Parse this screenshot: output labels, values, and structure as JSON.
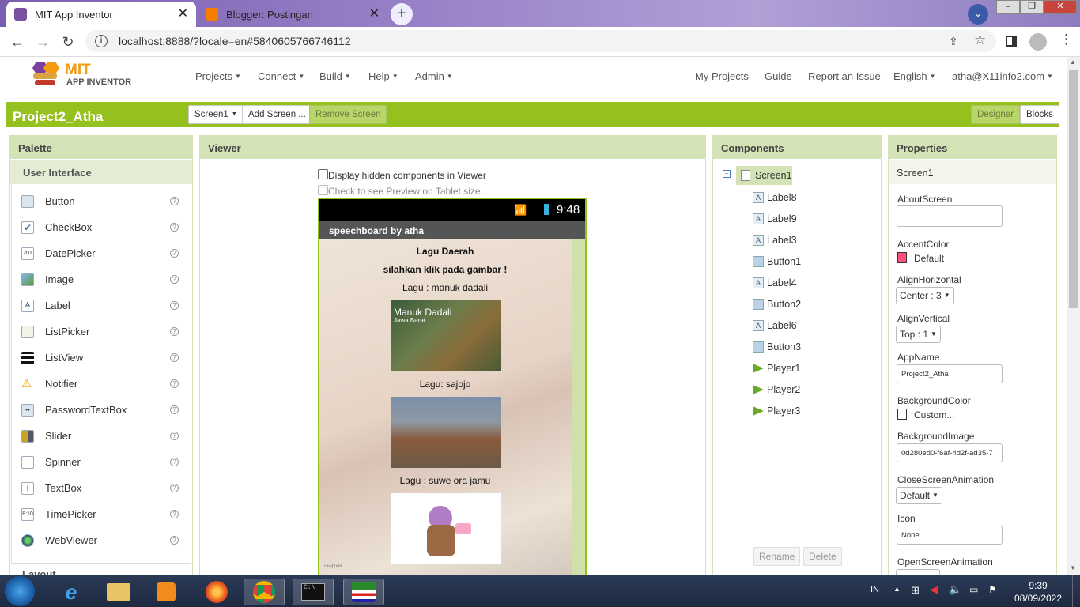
{
  "browser": {
    "tabs": [
      {
        "title": "MIT App Inventor",
        "active": true
      },
      {
        "title": "Blogger: Postingan",
        "active": false
      }
    ],
    "new_tab": "+",
    "url": "localhost:8888/?locale=en#5840605766746112",
    "window_controls": [
      "–",
      "❐",
      "✕"
    ]
  },
  "app": {
    "logo_top": "MIT",
    "logo_bottom": "APP INVENTOR",
    "menu": [
      "Projects",
      "Connect",
      "Build",
      "Help",
      "Admin"
    ],
    "right_menu": [
      "My Projects",
      "Guide",
      "Report an Issue",
      "English",
      "atha@X11info2.com"
    ]
  },
  "toolbar": {
    "project": "Project2_Atha",
    "screen_select": "Screen1",
    "add_screen": "Add Screen ...",
    "remove_screen": "Remove Screen",
    "designer": "Designer",
    "blocks": "Blocks"
  },
  "palette": {
    "title": "Palette",
    "section": "User Interface",
    "items": [
      "Button",
      "CheckBox",
      "DatePicker",
      "Image",
      "Label",
      "ListPicker",
      "ListView",
      "Notifier",
      "PasswordTextBox",
      "Slider",
      "Spinner",
      "TextBox",
      "TimePicker",
      "WebViewer"
    ],
    "next_section": "Layout"
  },
  "viewer": {
    "title": "Viewer",
    "hidden_cb": "Display hidden components in Viewer",
    "tablet_cb": "Check to see Preview on Tablet size.",
    "time": "9:48",
    "app_title": "speechboard by atha",
    "labels": [
      "Lagu Daerah",
      "silahkan klik pada gambar !",
      "Lagu : manuk dadali",
      "Lagu: sajojo",
      "Lagu : suwe ora jamu"
    ],
    "img1_title": "Manuk Dadali",
    "img1_sub": "Jawa Barat",
    "watermark": "rawpixel"
  },
  "components": {
    "title": "Components",
    "root": "Screen1",
    "items": [
      {
        "name": "Label8",
        "type": "label"
      },
      {
        "name": "Label9",
        "type": "label"
      },
      {
        "name": "Label3",
        "type": "label"
      },
      {
        "name": "Button1",
        "type": "button"
      },
      {
        "name": "Label4",
        "type": "label"
      },
      {
        "name": "Button2",
        "type": "button"
      },
      {
        "name": "Label6",
        "type": "label"
      },
      {
        "name": "Button3",
        "type": "button"
      },
      {
        "name": "Player1",
        "type": "player"
      },
      {
        "name": "Player2",
        "type": "player"
      },
      {
        "name": "Player3",
        "type": "player"
      }
    ],
    "rename": "Rename",
    "delete": "Delete"
  },
  "properties": {
    "title": "Properties",
    "screen": "Screen1",
    "about_label": "AboutScreen",
    "accent_label": "AccentColor",
    "accent_value": "Default",
    "accent_color": "#ff4f7a",
    "alignh_label": "AlignHorizontal",
    "alignh_value": "Center : 3",
    "alignv_label": "AlignVertical",
    "alignv_value": "Top : 1",
    "appname_label": "AppName",
    "appname_value": "Project2_Atha",
    "bgcolor_label": "BackgroundColor",
    "bgcolor_value": "Custom...",
    "bgimage_label": "BackgroundImage",
    "bgimage_value": "0d280ed0-f6af-4d2f-ad35-7",
    "close_anim_label": "CloseScreenAnimation",
    "close_anim_value": "Default",
    "icon_label": "Icon",
    "icon_value": "None...",
    "open_anim_label": "OpenScreenAnimation"
  },
  "taskbar": {
    "lang": "IN",
    "time": "9:39",
    "date": "08/09/2022"
  },
  "colors": {
    "brand_green": "#95c11f",
    "panel_head": "#d4e3b5"
  }
}
